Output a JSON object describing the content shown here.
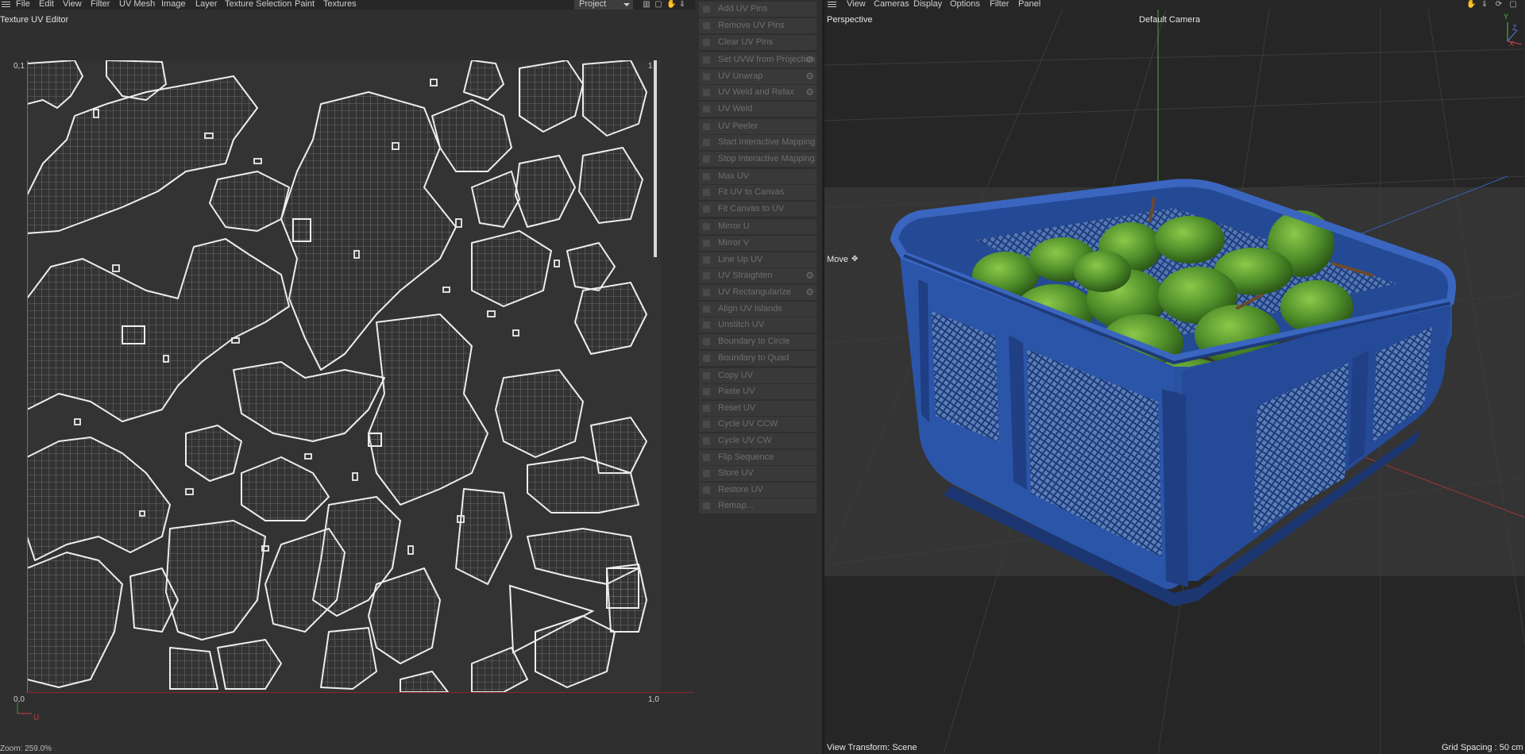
{
  "menubar_left": {
    "items": [
      "File",
      "Edit",
      "View",
      "Filter",
      "UV Mesh",
      "Image",
      "Layer",
      "Texture Selection",
      "Paint",
      "Textures"
    ],
    "project_select": "Project"
  },
  "uv_editor": {
    "title": "Texture UV Editor",
    "label_top_left": "0,1",
    "label_top_right": "1",
    "label_bottom_left": "0,0",
    "label_bottom_right": "1,0",
    "axis_label": "U",
    "zoom": "Zoom: 259.0%"
  },
  "commands": {
    "items": [
      {
        "label": "Add UV Pins",
        "gear": false
      },
      {
        "label": "Remove UV Pins",
        "gear": false
      },
      {
        "label": "Clear UV Pins",
        "gear": false
      },
      {
        "label": "Set UVW from Projection",
        "gear": true
      },
      {
        "label": "UV Unwrap",
        "gear": true
      },
      {
        "label": "UV Weld and Relax",
        "gear": true
      },
      {
        "label": "UV Weld",
        "gear": false
      },
      {
        "label": "UV Peeler",
        "gear": false
      },
      {
        "label": "Start Interactive Mapping",
        "gear": false
      },
      {
        "label": "Stop Interactive Mapping",
        "gear": false
      },
      {
        "label": "Max UV",
        "gear": false
      },
      {
        "label": "Fit UV to Canvas",
        "gear": false
      },
      {
        "label": "Fit Canvas to UV",
        "gear": false
      },
      {
        "label": "Mirror U",
        "gear": false
      },
      {
        "label": "Mirror V",
        "gear": false
      },
      {
        "label": "Line Up UV",
        "gear": false
      },
      {
        "label": "UV Straighten",
        "gear": true
      },
      {
        "label": "UV Rectangularize",
        "gear": true
      },
      {
        "label": "Align UV Islands",
        "gear": false
      },
      {
        "label": "Unstitch UV",
        "gear": false
      },
      {
        "label": "Boundary to Circle",
        "gear": false
      },
      {
        "label": "Boundary to Quad",
        "gear": false
      },
      {
        "label": "Copy UV",
        "gear": false
      },
      {
        "label": "Paste UV",
        "gear": false
      },
      {
        "label": "Reset UV",
        "gear": false
      },
      {
        "label": "Cycle UV CCW",
        "gear": false
      },
      {
        "label": "Cycle UV CW",
        "gear": false
      },
      {
        "label": "Flip Sequence",
        "gear": false
      },
      {
        "label": "Store UV",
        "gear": false
      },
      {
        "label": "Restore UV",
        "gear": false
      },
      {
        "label": "Remap...",
        "gear": false
      }
    ]
  },
  "viewport": {
    "menu": [
      "View",
      "Cameras",
      "Display",
      "Options",
      "Filter",
      "Panel"
    ],
    "view_name": "Perspective",
    "camera": "Default Camera",
    "tool": "Move",
    "view_transform": "View Transform: Scene",
    "grid_spacing": "Grid Spacing : 50 cm",
    "axis_y": "Y",
    "axis_z": "Z",
    "axis_x": "X"
  },
  "colors": {
    "crate": "#2f54a0",
    "crate_dark": "#1d3873",
    "fruit": "#5a9a2e",
    "uv_lines": "#e8e8e8"
  }
}
